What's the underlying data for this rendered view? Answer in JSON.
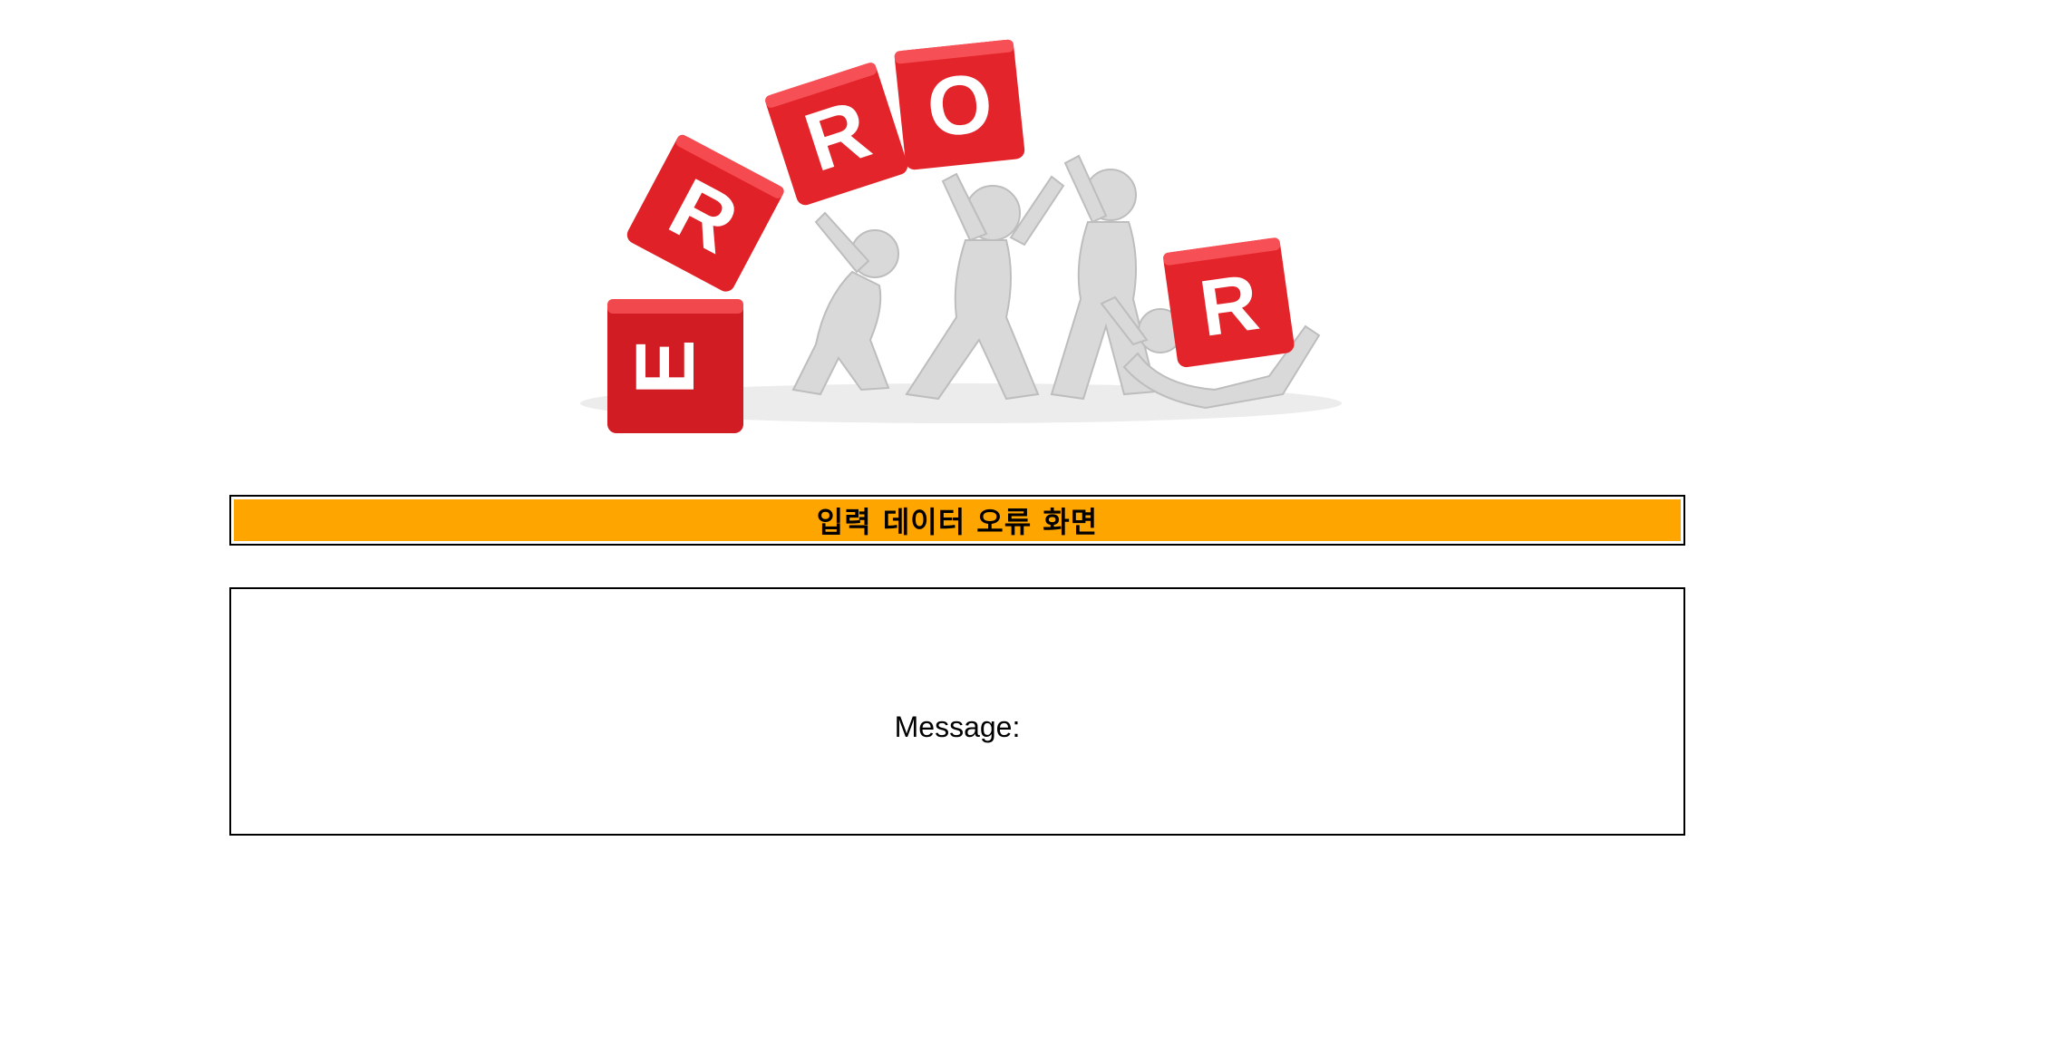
{
  "hero": {
    "letters": [
      "E",
      "R",
      "R",
      "O",
      "R"
    ],
    "cube_color": "#e8262c",
    "figure_color": "#d8d8d8"
  },
  "title": {
    "text": "입력 데이터 오류 화면",
    "background_color": "#ffa500"
  },
  "message": {
    "label": "Message:"
  }
}
